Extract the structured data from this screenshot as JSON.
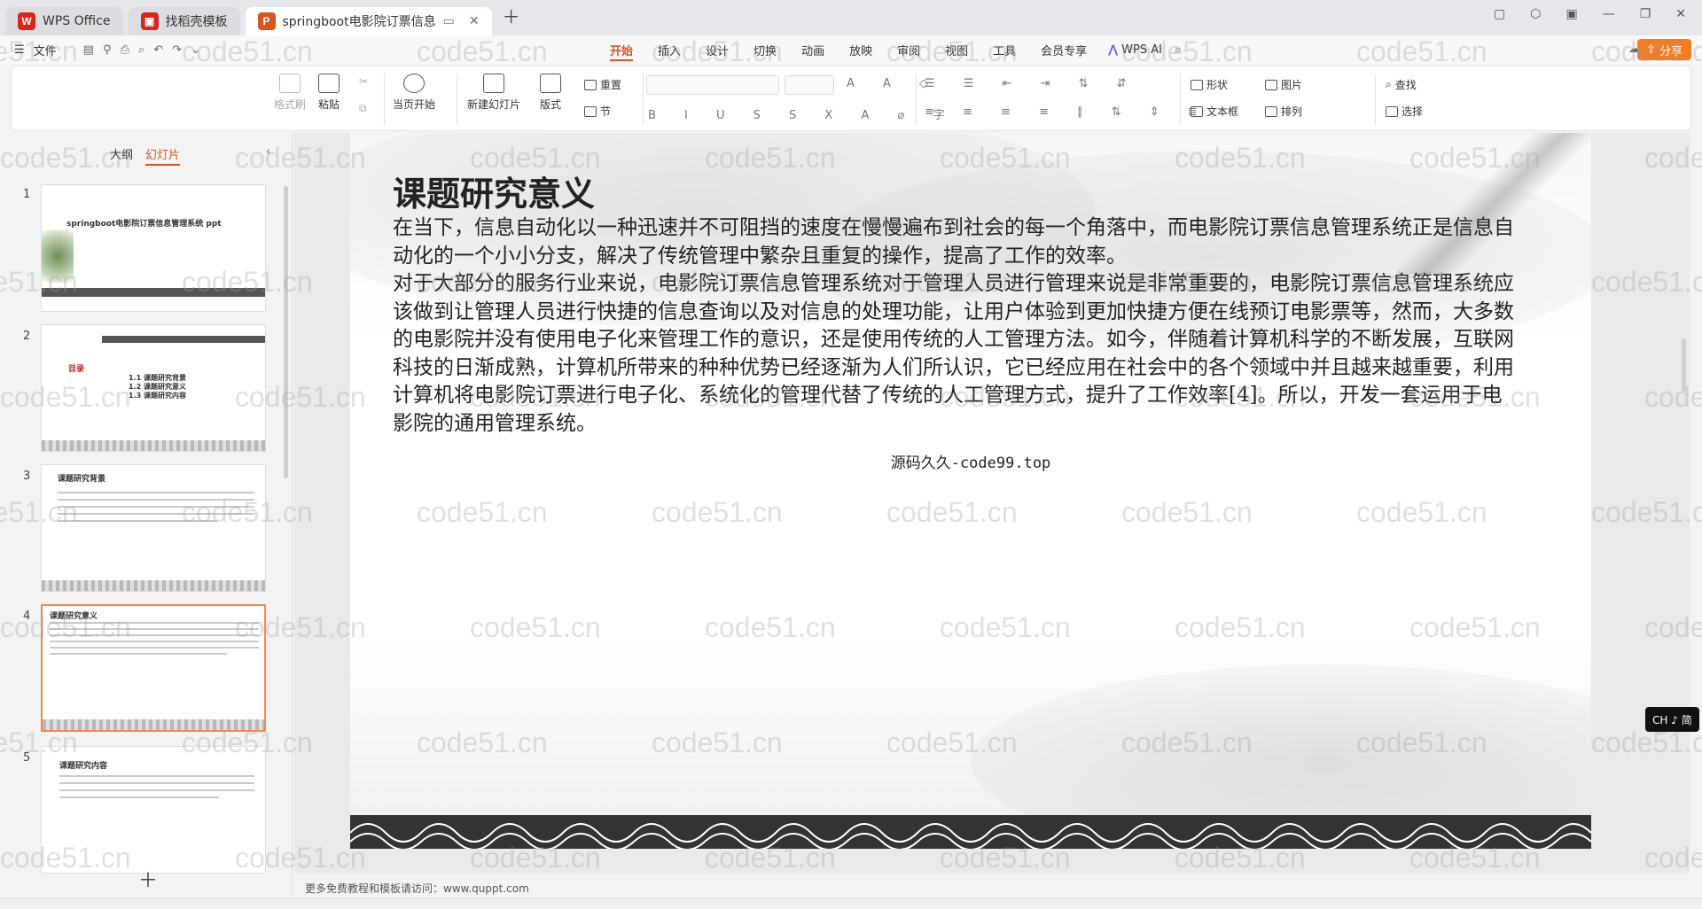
{
  "tabs": [
    {
      "label": "WPS Office",
      "color": "#d9251c",
      "state": "inactive"
    },
    {
      "label": "找稻壳模板",
      "color": "#d9251c",
      "state": "inactive"
    },
    {
      "label": "springboot电影院订票信息",
      "color": "#d9541e",
      "state": "active"
    }
  ],
  "menubar": {
    "file": "文件",
    "tabs": [
      "开始",
      "插入",
      "设计",
      "切换",
      "动画",
      "放映",
      "审阅",
      "视图",
      "工具",
      "会员专享"
    ],
    "active_tab": "开始",
    "wps_ai": "WPS AI",
    "share": "分享"
  },
  "ribbon": {
    "format_painter": "格式刷",
    "paste": "粘贴",
    "play_from_current": "当页开始",
    "new_slide": "新建幻灯片",
    "layout": "版式",
    "section": "节",
    "reset": "重置",
    "shape": "形状",
    "picture": "图片",
    "textbox": "文本框",
    "arrange": "排列",
    "find": "查找",
    "select": "选择"
  },
  "left_panel": {
    "tab_outline": "大纲",
    "tab_slides": "幻灯片",
    "thumbs": [
      {
        "num": "1",
        "title": "springboot电影院订票信息管理系统 ppt"
      },
      {
        "num": "2",
        "title": "目录",
        "items": [
          "1.1 课题研究背景",
          "1.2 课题研究意义",
          "1.3 课题研究内容"
        ]
      },
      {
        "num": "3",
        "title": "课题研究背景"
      },
      {
        "num": "4",
        "title": "课题研究意义"
      },
      {
        "num": "5",
        "title": "课题研究内容"
      }
    ],
    "selected": 4
  },
  "slide": {
    "title": "课题研究意义",
    "paragraphs": [
      " 在当下，信息自动化以一种迅速并不可阻挡的速度在慢慢遍布到社会的每一个角落中，而电影院订票信息管理系统正是信息自动化的一个小小分支，解决了传统管理中繁杂且重复的操作，提高了工作的效率。",
      "对于大部分的服务行业来说，电影院订票信息管理系统对于管理人员进行管理来说是非常重要的，电影院订票信息管理系统应该做到让管理人员进行快捷的信息查询以及对信息的处理功能，让用户体验到更加快捷方便在线预订电影票等，然而，大多数的电影院并没有使用电子化来管理工作的意识，还是使用传统的人工管理方法。如今，伴随着计算机科学的不断发展，互联网科技的日渐成熟，计算机所带来的种种优势已经逐渐为人们所认识，它已经应用在社会中的各个领域中并且越来越重要，利用计算机将电影院订票进行电子化、系统化的管理代替了传统的人工管理方式，提升了工作效率[4]。所以，开发一套运用于电影院的通用管理系统。"
    ],
    "source": "源码久久-code99.top"
  },
  "footer_note": "更多免费教程和模板请访问：www.quppt.com",
  "ime": "CH ♪ 简",
  "watermark": "code51.cn",
  "colors": {
    "accent": "#d9541e",
    "share": "#f47b20",
    "selected_border": "#f08a4b"
  }
}
